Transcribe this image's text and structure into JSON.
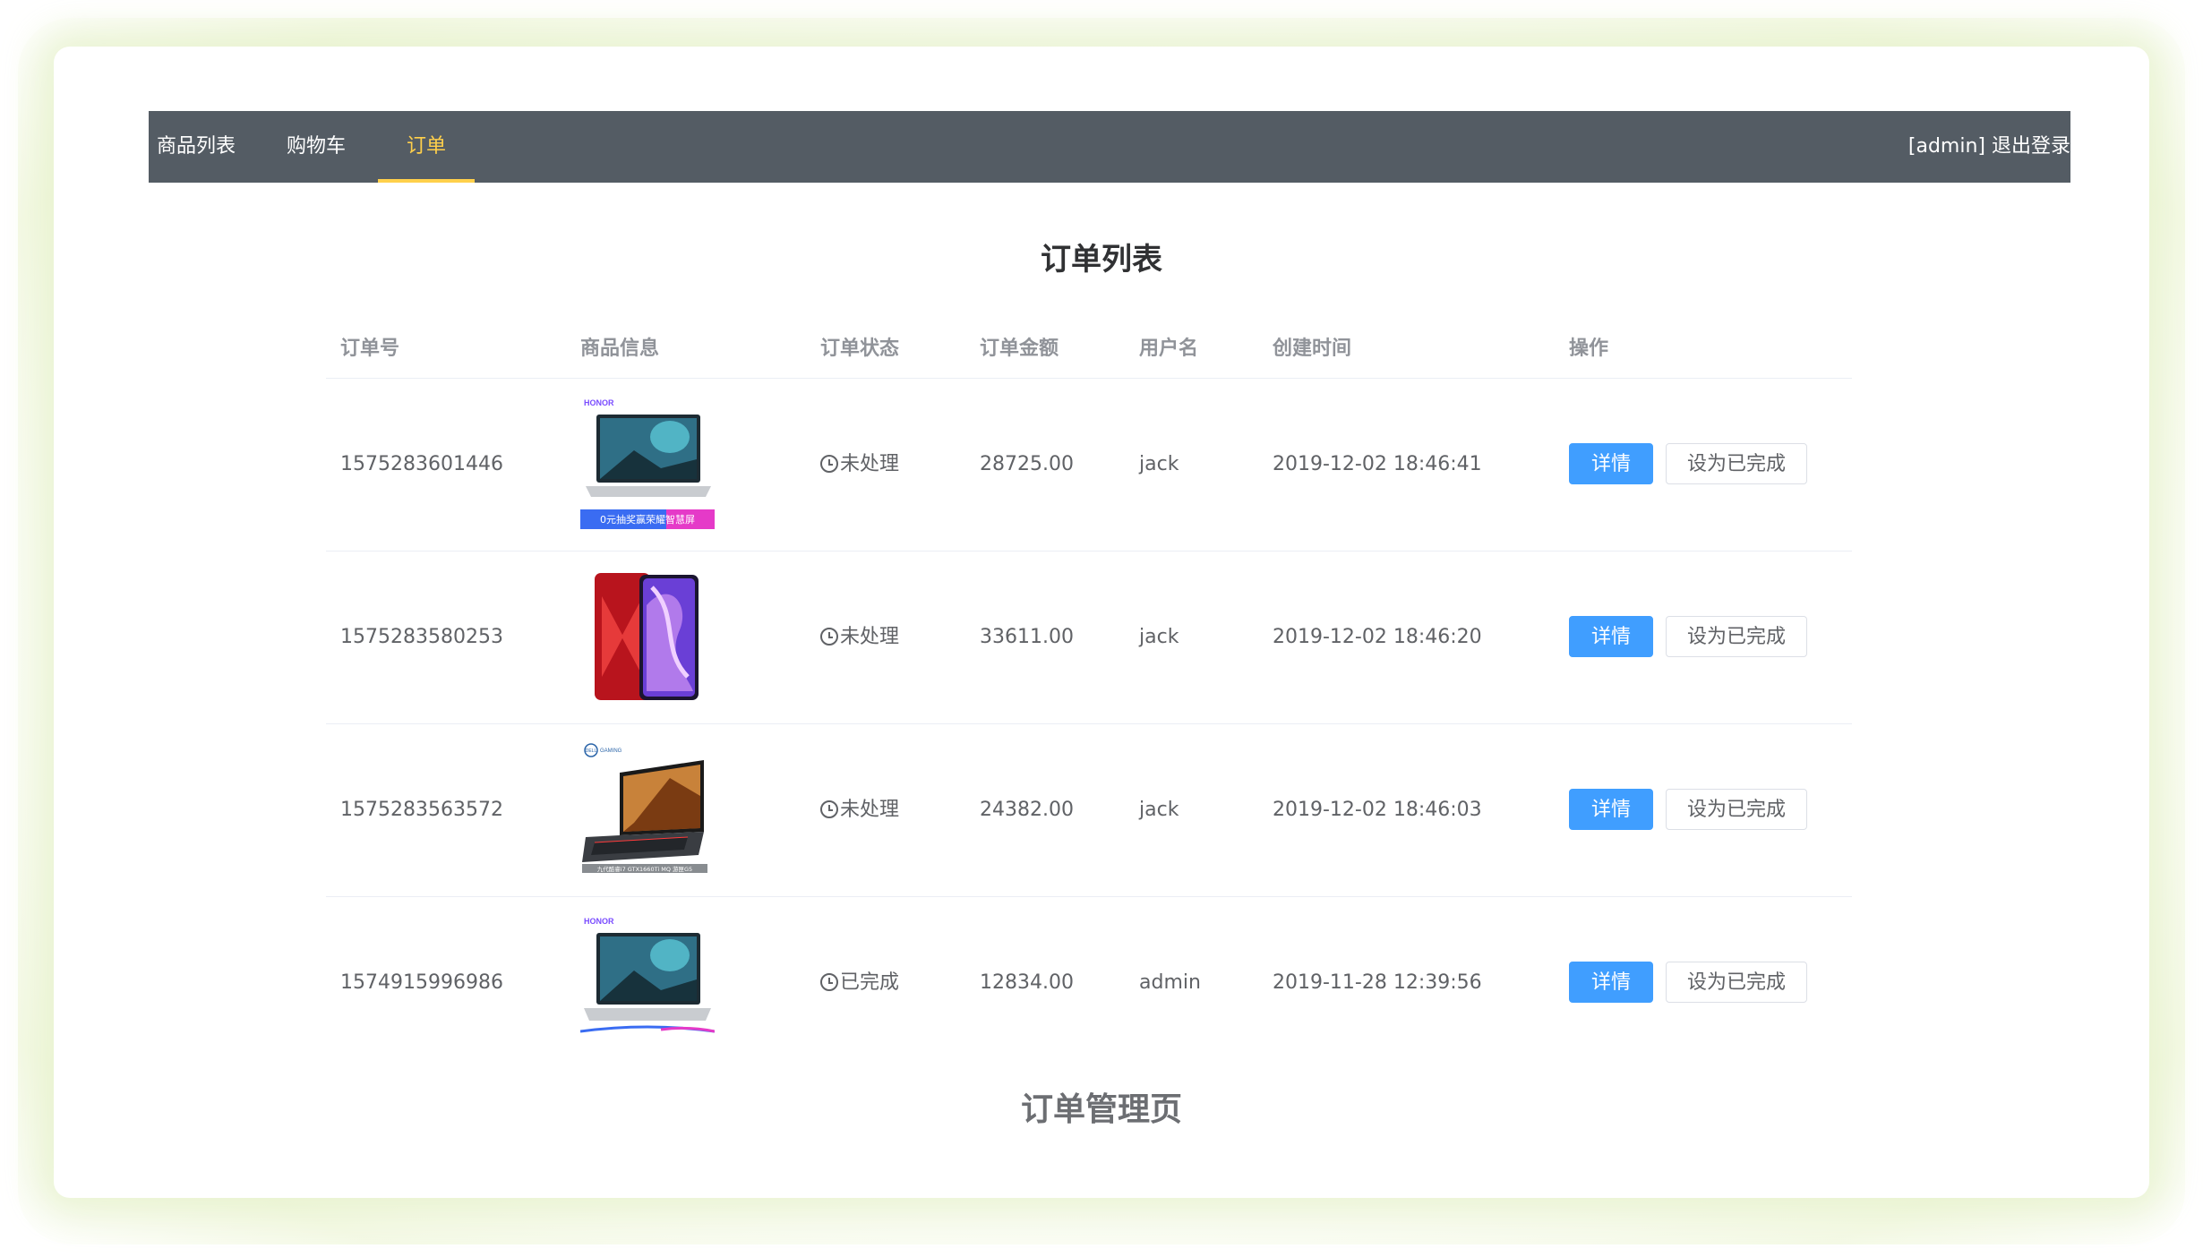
{
  "nav": {
    "items": [
      {
        "label": "商品列表",
        "active": false
      },
      {
        "label": "购物车",
        "active": false
      },
      {
        "label": "订单",
        "active": true
      }
    ],
    "user": "[admin] 退出登录"
  },
  "page": {
    "title": "订单列表",
    "footer": "订单管理页"
  },
  "table": {
    "headers": [
      "订单号",
      "商品信息",
      "订单状态",
      "订单金额",
      "用户名",
      "创建时间",
      "操作"
    ],
    "rows": [
      {
        "id": "1575283601446",
        "product": "honor-laptop",
        "status": "未处理",
        "amount": "28725.00",
        "user": "jack",
        "created": "2019-12-02 18:46:41",
        "banner": "0元抽奖赢荣耀智慧屏"
      },
      {
        "id": "1575283580253",
        "product": "honor-phone",
        "status": "未处理",
        "amount": "33611.00",
        "user": "jack",
        "created": "2019-12-02 18:46:20",
        "banner": ""
      },
      {
        "id": "1575283563572",
        "product": "dell-gaming-laptop",
        "status": "未处理",
        "amount": "24382.00",
        "user": "jack",
        "created": "2019-12-02 18:46:03",
        "banner": ""
      },
      {
        "id": "1574915996986",
        "product": "honor-laptop",
        "status": "已完成",
        "amount": "12834.00",
        "user": "admin",
        "created": "2019-11-28 12:39:56",
        "banner": ""
      }
    ],
    "actions": {
      "detail": "详情",
      "complete": "设为已完成"
    }
  },
  "colors": {
    "navbar_bg": "#545c64",
    "nav_active": "#ffd04b",
    "primary": "#409eff"
  },
  "images": {
    "honor_logo": "HONOR",
    "dell_logo": "DELL",
    "dell_sub": "GAMING",
    "dell_banner": "九代酷睿i7 GTX1660Ti MQ 游匣G5"
  }
}
